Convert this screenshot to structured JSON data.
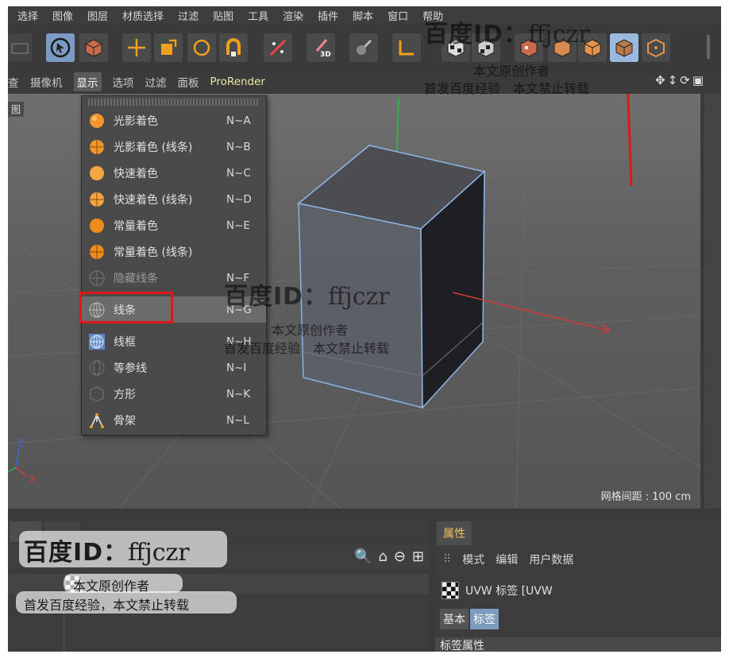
{
  "menubar": [
    "选择",
    "图像",
    "图层",
    "材质选择",
    "过滤",
    "贴图",
    "工具",
    "渲染",
    "插件",
    "脚本",
    "窗口",
    "帮助"
  ],
  "toolbar": {
    "buttons": [
      "cursor",
      "cube-view",
      "move",
      "scale",
      "rotate",
      "magnet",
      "checker",
      "paint",
      "paint-3d",
      "sculpt",
      "axis",
      "checker-cube",
      "checker-cube-2",
      "points",
      "edges",
      "polygons",
      "uv-polygons",
      "object"
    ],
    "badge_3d": "3D"
  },
  "viewport_header": {
    "items": [
      "查看",
      "摄像机",
      "显示",
      "选项",
      "过滤",
      "面板",
      "ProRender"
    ],
    "nav_icons": [
      "↕",
      "⟳",
      "▣"
    ]
  },
  "viewport": {
    "label": "图",
    "grid_spacing": "网格间距 : 100 cm",
    "axis_z": "Z",
    "axis_x": "X"
  },
  "display_menu": {
    "items": [
      {
        "label": "光影着色",
        "shortcut": "N~A",
        "icon": "gouraud-icon"
      },
      {
        "label": "光影着色 (线条)",
        "shortcut": "N~B",
        "icon": "gouraud-lines-icon"
      },
      {
        "label": "快速着色",
        "shortcut": "N~C",
        "icon": "quick-icon"
      },
      {
        "label": "快速着色 (线条)",
        "shortcut": "N~D",
        "icon": "quick-lines-icon"
      },
      {
        "label": "常量着色",
        "shortcut": "N~E",
        "icon": "constant-icon"
      },
      {
        "label": "常量着色 (线条)",
        "shortcut": "",
        "icon": "constant-lines-icon"
      },
      {
        "label": "隐藏线条",
        "shortcut": "N~F",
        "icon": "hidden-line-icon"
      },
      {
        "label": "线条",
        "shortcut": "N~G",
        "icon": "lines-icon"
      },
      {
        "label": "线框",
        "shortcut": "N~H",
        "icon": "wireframe-icon"
      },
      {
        "label": "等参线",
        "shortcut": "N~I",
        "icon": "isoparm-icon"
      },
      {
        "label": "方形",
        "shortcut": "N~K",
        "icon": "box-icon"
      },
      {
        "label": "骨架",
        "shortcut": "N~L",
        "icon": "skeleton-icon"
      }
    ]
  },
  "attributes": {
    "tab": "属性",
    "menu": [
      "模式",
      "编辑",
      "用户数据"
    ],
    "object_name": "UVW 标签 [UVW",
    "tabs": [
      "基本",
      "标签"
    ],
    "section": "标签属性"
  },
  "objects_panel": {
    "icons": [
      "🔍",
      "⌂",
      "⊖",
      "⊞"
    ]
  },
  "watermark": {
    "id_prefix": "百度ID：",
    "id_name": "ffjczr",
    "line1": "本文原创作者",
    "line2": "首发百度经验　本文禁止转载",
    "line2_alt": "首发百度经验，本文禁止转载"
  },
  "colors": {
    "accent": "#7b9bc4",
    "menu_highlight": "#6b6b6b",
    "annotation_red": "#e01818",
    "orange_icon": "#f0962a"
  }
}
